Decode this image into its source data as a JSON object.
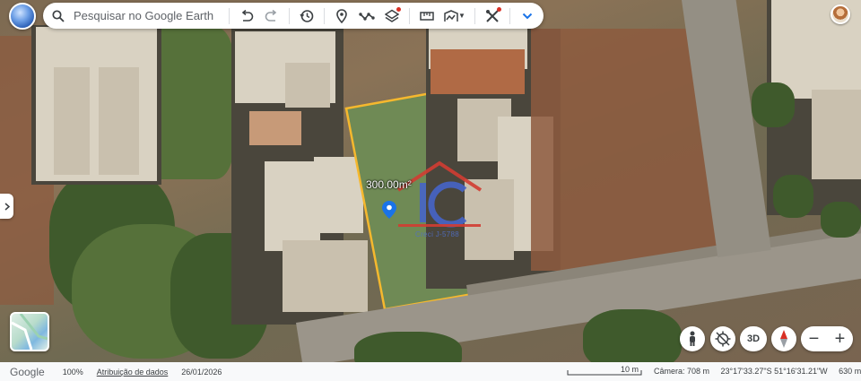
{
  "search": {
    "placeholder": "Pesquisar no Google Earth"
  },
  "toolbar": {
    "buttons": [
      {
        "name": "undo-icon"
      },
      {
        "name": "redo-icon"
      },
      {
        "name": "history-icon"
      },
      {
        "name": "add-placemark-icon"
      },
      {
        "name": "draw-path-icon"
      },
      {
        "name": "layers-icon"
      },
      {
        "name": "measure-icon"
      },
      {
        "name": "map-style-icon"
      },
      {
        "name": "tools-icon"
      },
      {
        "name": "expand-icon"
      }
    ],
    "notification_color": "#d93025"
  },
  "map": {
    "area_label": "300.00m²",
    "watermark_text": "Creci J-5788",
    "outline_color": "#f5b82e"
  },
  "controls": {
    "threed_label": "3D"
  },
  "status": {
    "brand": "Google",
    "zoom": "100%",
    "attribution": "Atribuição de dados",
    "date": "26/01/2026",
    "scale": "10 m",
    "camera": "Câmera: 708 m",
    "coordinates": "23°17'33.27\"S 51°16'31.21\"W",
    "elevation": "630 m"
  }
}
